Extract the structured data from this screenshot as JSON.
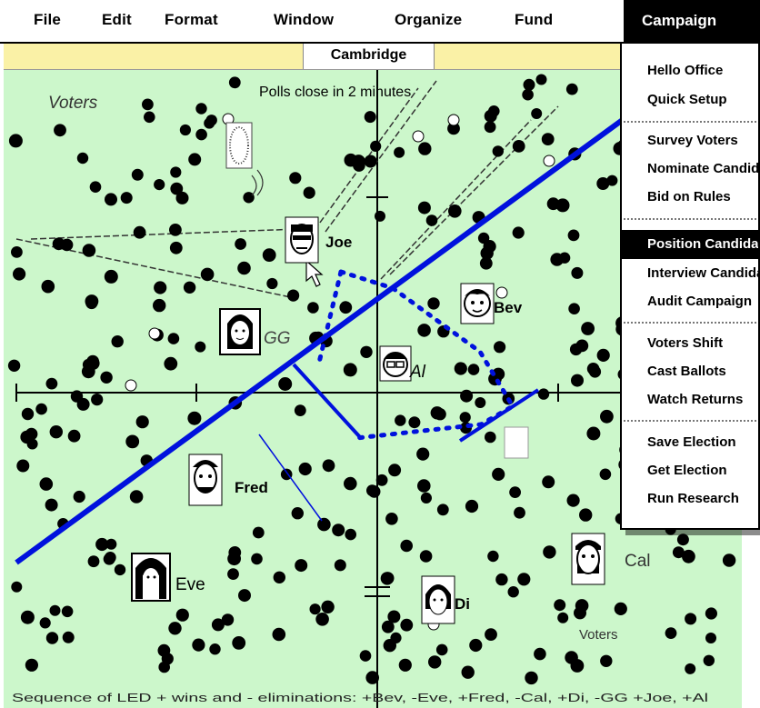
{
  "menubar": {
    "items": [
      {
        "label": "File"
      },
      {
        "label": "Edit"
      },
      {
        "label": "Format"
      },
      {
        "label": "Window"
      },
      {
        "label": "Organize"
      },
      {
        "label": "Fund"
      }
    ],
    "active": {
      "label": "Campaign"
    }
  },
  "window": {
    "title": "Cambridge"
  },
  "dropdown": {
    "items": [
      {
        "label": "Hello Office"
      },
      {
        "label": "Quick Setup"
      },
      {
        "label": "Survey Voters"
      },
      {
        "label": "Nominate Candidates"
      },
      {
        "label": "Bid on Rules"
      },
      {
        "label": "Position Candidates"
      },
      {
        "label": "Interview Candidates"
      },
      {
        "label": "Audit Campaign"
      },
      {
        "label": "Voters Shift"
      },
      {
        "label": "Cast Ballots"
      },
      {
        "label": "Watch Returns"
      },
      {
        "label": "Save Election"
      },
      {
        "label": "Get Election"
      },
      {
        "label": "Run Research"
      }
    ],
    "highlighted": "Position Candidates"
  },
  "stage": {
    "status": "Polls close in 2 minutes",
    "voters_label_top": "Voters",
    "voters_label_bottom": "Voters",
    "footer": "Sequence of LED + wins and - eliminations: +Bev, -Eve, +Fred, -Cal, +Di, -GG +Joe, +Al",
    "candidates": [
      {
        "name": "Joe"
      },
      {
        "name": "Bev"
      },
      {
        "name": "GG"
      },
      {
        "name": "Al"
      },
      {
        "name": "Fred"
      },
      {
        "name": "Eve"
      },
      {
        "name": "Di"
      },
      {
        "name": "Cal"
      }
    ]
  },
  "colors": {
    "menu_bg": "#ffffff",
    "title_bar": "#faf1a6",
    "stage_bg": "#ccf7cb",
    "annotation_blue": "#0011dd",
    "voter_dot": "#000000"
  }
}
